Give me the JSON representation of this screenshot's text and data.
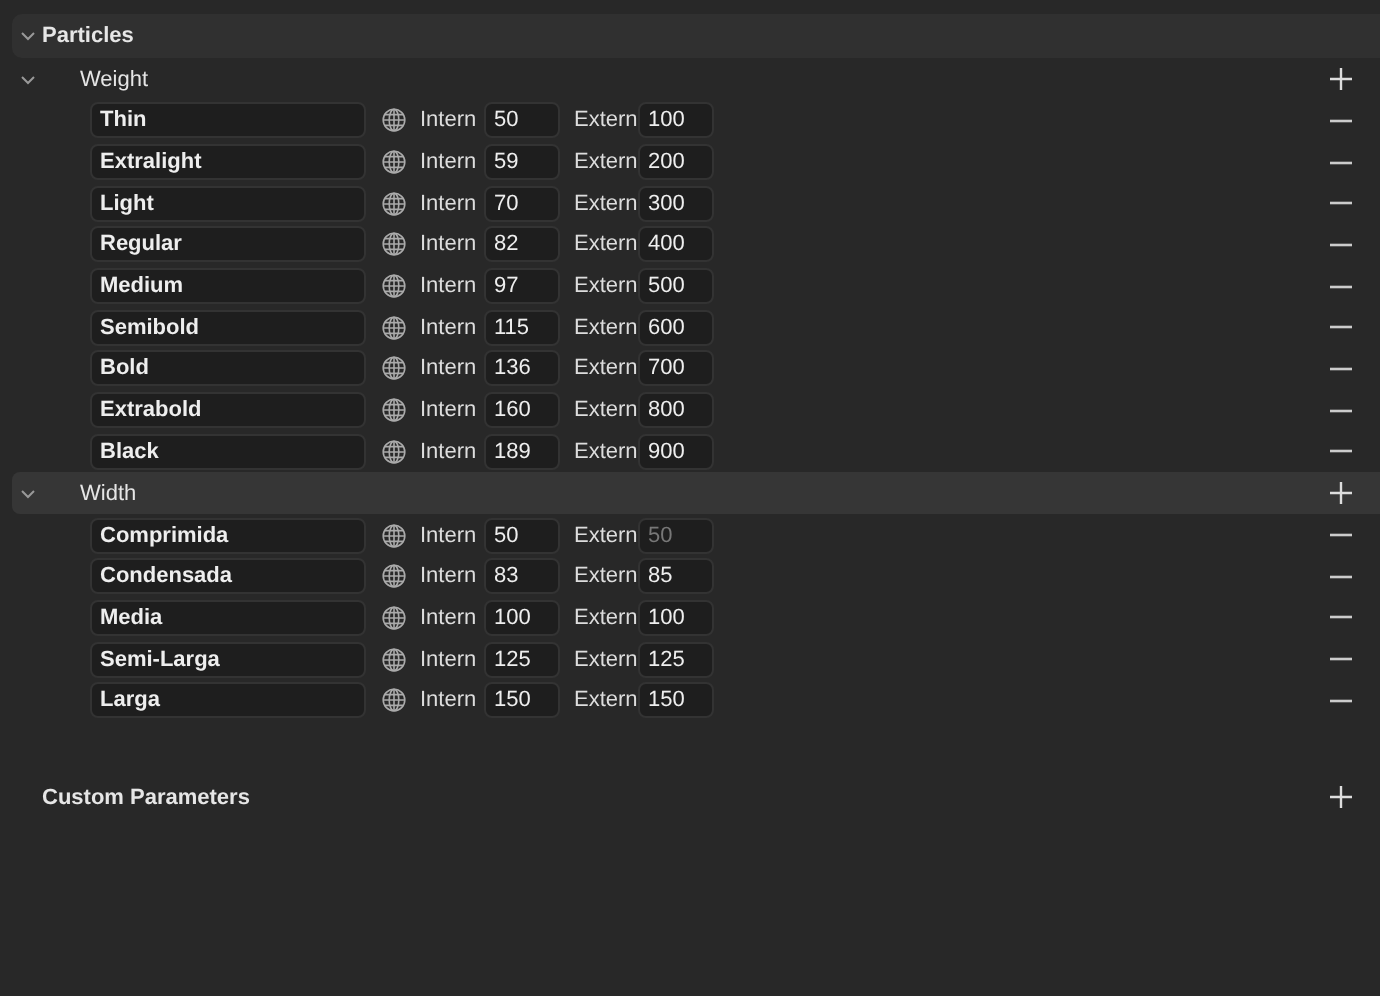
{
  "section": {
    "title": "Particles",
    "expanded": true
  },
  "groups": [
    {
      "title": "Weight",
      "expanded": true,
      "selected": false,
      "rows": [
        {
          "name": "Thin",
          "intern_label": "Intern",
          "intern": "50",
          "extern_label": "Extern",
          "extern": "100"
        },
        {
          "name": "Extralight",
          "intern_label": "Intern",
          "intern": "59",
          "extern_label": "Extern",
          "extern": "200"
        },
        {
          "name": "Light",
          "intern_label": "Intern",
          "intern": "70",
          "extern_label": "Extern",
          "extern": "300"
        },
        {
          "name": "Regular",
          "intern_label": "Intern",
          "intern": "82",
          "extern_label": "Extern",
          "extern": "400"
        },
        {
          "name": "Medium",
          "intern_label": "Intern",
          "intern": "97",
          "extern_label": "Extern",
          "extern": "500"
        },
        {
          "name": "Semibold",
          "intern_label": "Intern",
          "intern": "115",
          "extern_label": "Extern",
          "extern": "600"
        },
        {
          "name": "Bold",
          "intern_label": "Intern",
          "intern": "136",
          "extern_label": "Extern",
          "extern": "700"
        },
        {
          "name": "Extrabold",
          "intern_label": "Intern",
          "intern": "160",
          "extern_label": "Extern",
          "extern": "800"
        },
        {
          "name": "Black",
          "intern_label": "Intern",
          "intern": "189",
          "extern_label": "Extern",
          "extern": "900"
        }
      ]
    },
    {
      "title": "Width",
      "expanded": true,
      "selected": true,
      "rows": [
        {
          "name": "Comprimida",
          "intern_label": "Intern",
          "intern": "50",
          "extern_label": "Extern",
          "extern_placeholder": "50"
        },
        {
          "name": "Condensada",
          "intern_label": "Intern",
          "intern": "83",
          "extern_label": "Extern",
          "extern": "85"
        },
        {
          "name": "Media",
          "intern_label": "Intern",
          "intern": "100",
          "extern_label": "Extern",
          "extern": "100"
        },
        {
          "name": "Semi-Larga",
          "intern_label": "Intern",
          "intern": "125",
          "extern_label": "Extern",
          "extern": "125"
        },
        {
          "name": "Larga",
          "intern_label": "Intern",
          "intern": "150",
          "extern_label": "Extern",
          "extern": "150"
        }
      ]
    }
  ],
  "custom_parameters": {
    "title": "Custom Parameters"
  }
}
